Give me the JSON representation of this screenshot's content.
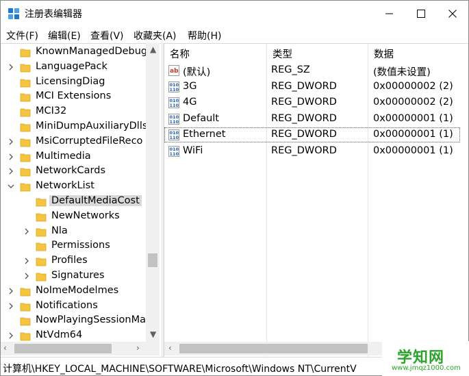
{
  "window": {
    "title": "注册表编辑器",
    "controls": {
      "minimize": "—",
      "maximize": "☐",
      "close": "✕"
    }
  },
  "menu": [
    "文件(F)",
    "编辑(E)",
    "查看(V)",
    "收藏夹(A)",
    "帮助(H)"
  ],
  "tree": {
    "items": [
      {
        "label": "KnownManagedDebug",
        "expandable": false
      },
      {
        "label": "LanguagePack",
        "expandable": true
      },
      {
        "label": "LicensingDiag",
        "expandable": false
      },
      {
        "label": "MCI Extensions",
        "expandable": false
      },
      {
        "label": "MCI32",
        "expandable": false
      },
      {
        "label": "MiniDumpAuxiliaryDlls",
        "expandable": false
      },
      {
        "label": "MsiCorruptedFileReco",
        "expandable": true
      },
      {
        "label": "Multimedia",
        "expandable": true
      },
      {
        "label": "NetworkCards",
        "expandable": true
      },
      {
        "label": "NetworkList",
        "expandable": true,
        "expanded": true
      },
      {
        "label": "DefaultMediaCost",
        "expandable": false,
        "child": true,
        "selected": true
      },
      {
        "label": "NewNetworks",
        "expandable": false,
        "child": true
      },
      {
        "label": "Nla",
        "expandable": true,
        "child": true
      },
      {
        "label": "Permissions",
        "expandable": false,
        "child": true
      },
      {
        "label": "Profiles",
        "expandable": true,
        "child": true
      },
      {
        "label": "Signatures",
        "expandable": true,
        "child": true
      },
      {
        "label": "NoImeModelmes",
        "expandable": true
      },
      {
        "label": "Notifications",
        "expandable": true
      },
      {
        "label": "NowPlayingSessionMa",
        "expandable": false
      },
      {
        "label": "NtVdm64",
        "expandable": true
      }
    ]
  },
  "list": {
    "columns": [
      "名称",
      "类型",
      "数据"
    ],
    "rows": [
      {
        "name": "(默认)",
        "type": "REG_SZ",
        "data": "(数值未设置)",
        "icon": "string-value-icon"
      },
      {
        "name": "3G",
        "type": "REG_DWORD",
        "data": "0x00000002 (2)",
        "icon": "binary-value-icon"
      },
      {
        "name": "4G",
        "type": "REG_DWORD",
        "data": "0x00000002 (2)",
        "icon": "binary-value-icon"
      },
      {
        "name": "Default",
        "type": "REG_DWORD",
        "data": "0x00000001 (1)",
        "icon": "binary-value-icon"
      },
      {
        "name": "Ethernet",
        "type": "REG_DWORD",
        "data": "0x00000001 (1)",
        "icon": "binary-value-icon",
        "focused": true
      },
      {
        "name": "WiFi",
        "type": "REG_DWORD",
        "data": "0x00000001 (1)",
        "icon": "binary-value-icon"
      }
    ]
  },
  "status": "计算机\\HKEY_LOCAL_MACHINE\\SOFTWARE\\Microsoft\\Windows NT\\CurrentV",
  "watermark": {
    "main": "学知网",
    "sub": "www.jmqz1000.com"
  },
  "colors": {
    "folder": "#f5c542",
    "selection": "#d9d9d9",
    "watermark": "#2aa52a"
  }
}
